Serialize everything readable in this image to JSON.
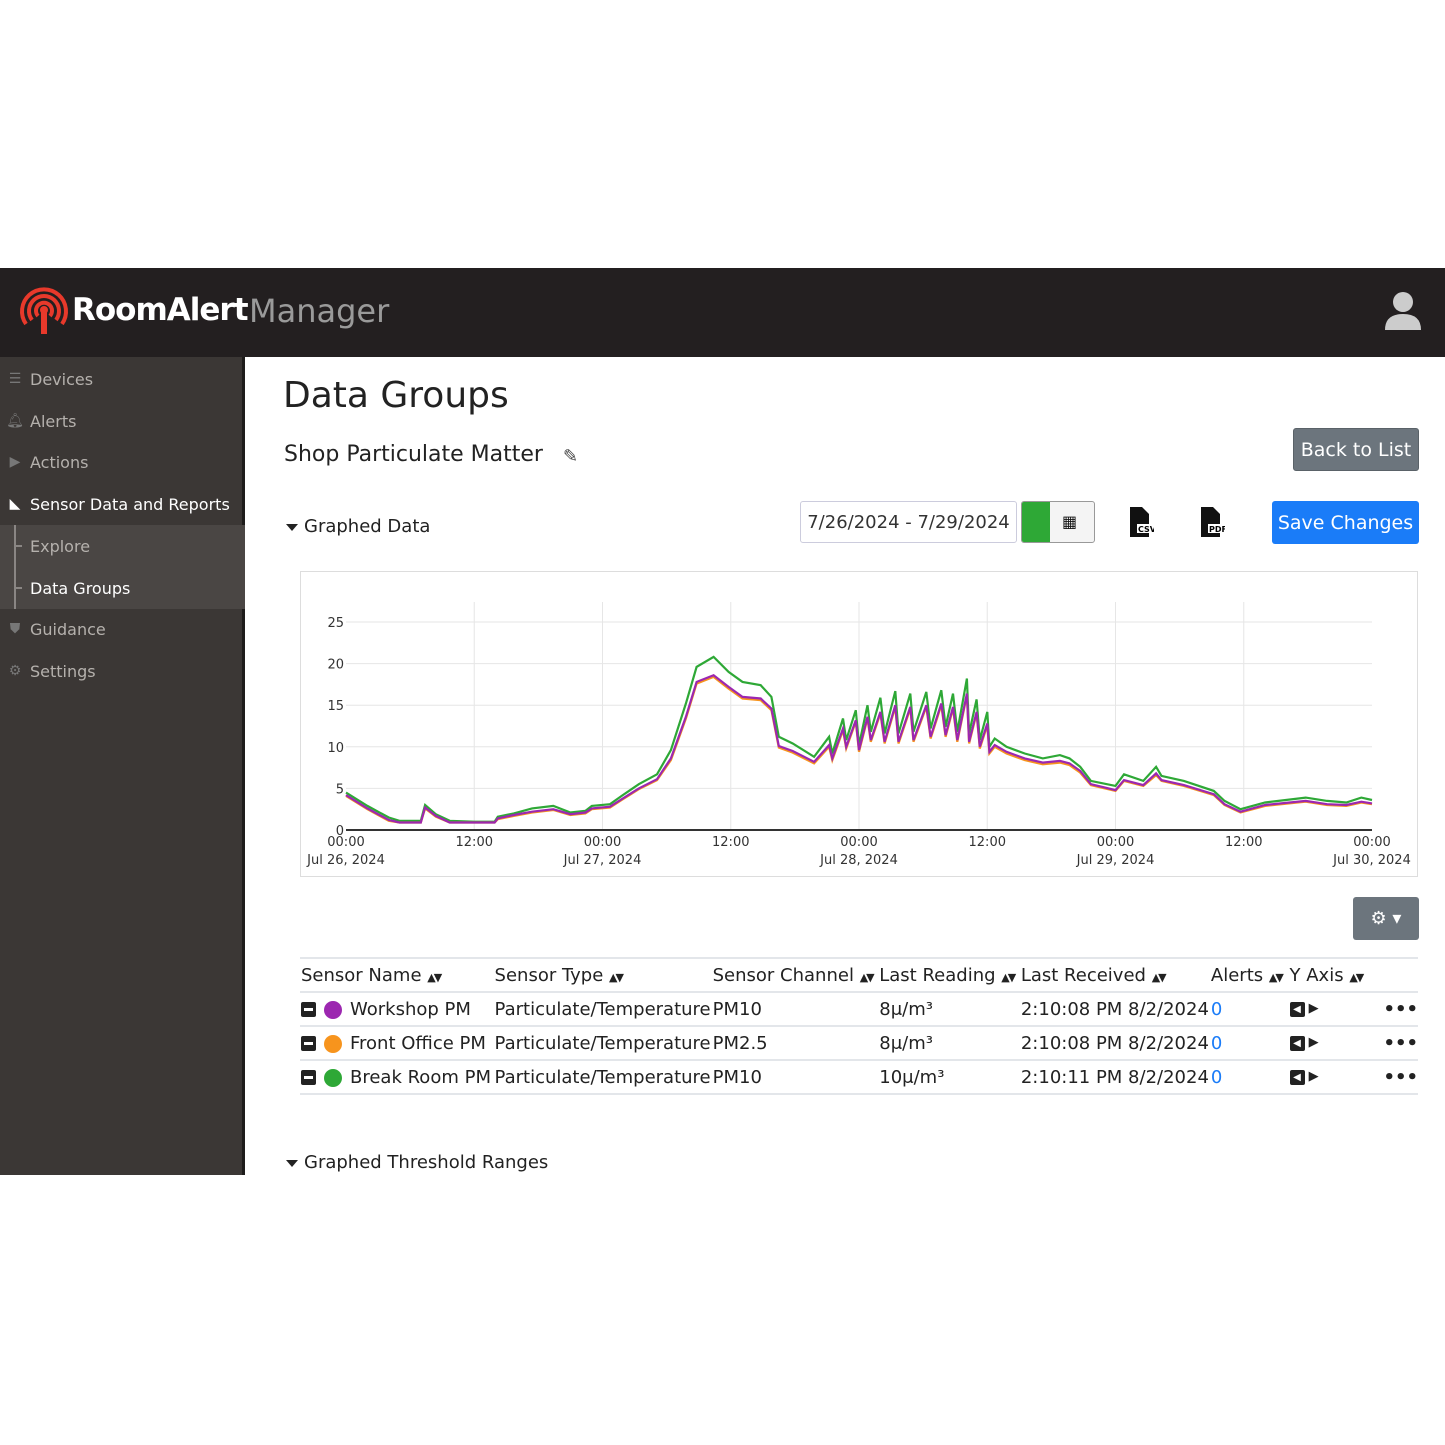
{
  "header": {
    "brand": "RoomAlert",
    "product": "Manager",
    "user_icon": "user-icon",
    "logo_color": "#e8392b"
  },
  "sidebar": {
    "items": [
      {
        "label": "Devices",
        "icon": "list-icon"
      },
      {
        "label": "Alerts",
        "icon": "bell-icon"
      },
      {
        "label": "Actions",
        "icon": "play-circle-icon"
      },
      {
        "label": "Sensor Data and Reports",
        "icon": "area-chart-icon",
        "active": true
      },
      {
        "label": "Explore",
        "sub": true
      },
      {
        "label": "Data Groups",
        "sub": true,
        "active": true
      },
      {
        "label": "Guidance",
        "icon": "shield-icon"
      },
      {
        "label": "Settings",
        "icon": "gear-icon"
      }
    ]
  },
  "main": {
    "title": "Data Groups",
    "group_name": "Shop Particulate Matter",
    "back_label": "Back to List",
    "graphed_data_label": "Graphed Data",
    "date_range": "7/26/2024 - 7/29/2024",
    "selected_color": "#2ea836",
    "csv_label": "CSV",
    "pdf_label": "PDF",
    "save_label": "Save Changes",
    "threshold_label": "Graphed Threshold Ranges"
  },
  "chart_data": {
    "type": "line",
    "ylim": [
      0,
      25
    ],
    "yticks": [
      0,
      5,
      10,
      15,
      20,
      25
    ],
    "xlim": [
      "2024-07-26T00:00",
      "2024-07-30T00:00"
    ],
    "xticks": [
      {
        "time": "2024-07-26T00:00",
        "label": "00:00",
        "date": "Jul 26, 2024"
      },
      {
        "time": "2024-07-26T12:00",
        "label": "12:00",
        "date": ""
      },
      {
        "time": "2024-07-27T00:00",
        "label": "00:00",
        "date": "Jul 27, 2024"
      },
      {
        "time": "2024-07-27T12:00",
        "label": "12:00",
        "date": ""
      },
      {
        "time": "2024-07-28T00:00",
        "label": "00:00",
        "date": "Jul 28, 2024"
      },
      {
        "time": "2024-07-28T12:00",
        "label": "12:00",
        "date": ""
      },
      {
        "time": "2024-07-29T00:00",
        "label": "00:00",
        "date": "Jul 29, 2024"
      },
      {
        "time": "2024-07-29T12:00",
        "label": "12:00",
        "date": ""
      },
      {
        "time": "2024-07-30T00:00",
        "label": "00:00",
        "date": "Jul 30, 2024"
      }
    ],
    "grid": true,
    "x": [
      "2024-07-26T00:00",
      "2024-07-26T02:00",
      "2024-07-26T04:00",
      "2024-07-26T05:00",
      "2024-07-26T07:00",
      "2024-07-26T07:24",
      "2024-07-26T08:24",
      "2024-07-26T09:42",
      "2024-07-26T12:00",
      "2024-07-26T13:54",
      "2024-07-26T14:12",
      "2024-07-26T15:42",
      "2024-07-26T17:24",
      "2024-07-26T19:24",
      "2024-07-26T21:00",
      "2024-07-26T22:24",
      "2024-07-26T23:00",
      "2024-07-27T00:42",
      "2024-07-27T01:48",
      "2024-07-27T03:24",
      "2024-07-27T05:06",
      "2024-07-27T06:24",
      "2024-07-27T07:48",
      "2024-07-27T08:48",
      "2024-07-27T10:24",
      "2024-07-27T11:48",
      "2024-07-27T13:06",
      "2024-07-27T14:48",
      "2024-07-27T15:48",
      "2024-07-27T16:30",
      "2024-07-27T17:48",
      "2024-07-27T19:48",
      "2024-07-27T21:12",
      "2024-07-27T21:30",
      "2024-07-27T22:30",
      "2024-07-27T22:48",
      "2024-07-27T23:42",
      "2024-07-28T00:00",
      "2024-07-28T00:48",
      "2024-07-28T01:06",
      "2024-07-28T02:00",
      "2024-07-28T02:24",
      "2024-07-28T03:24",
      "2024-07-28T03:42",
      "2024-07-28T04:48",
      "2024-07-28T05:06",
      "2024-07-28T06:18",
      "2024-07-28T06:42",
      "2024-07-28T07:42",
      "2024-07-28T08:06",
      "2024-07-28T08:48",
      "2024-07-28T09:12",
      "2024-07-28T10:06",
      "2024-07-28T10:18",
      "2024-07-28T11:00",
      "2024-07-28T11:18",
      "2024-07-28T12:00",
      "2024-07-28T12:12",
      "2024-07-28T12:42",
      "2024-07-28T13:48",
      "2024-07-28T15:30",
      "2024-07-28T17:12",
      "2024-07-28T18:48",
      "2024-07-28T19:42",
      "2024-07-28T20:42",
      "2024-07-28T21:42",
      "2024-07-29T00:00",
      "2024-07-29T00:48",
      "2024-07-29T02:36",
      "2024-07-29T03:48",
      "2024-07-29T04:18",
      "2024-07-29T06:24",
      "2024-07-29T09:12",
      "2024-07-29T10:12",
      "2024-07-29T11:42",
      "2024-07-29T14:00",
      "2024-07-29T17:48",
      "2024-07-29T19:48",
      "2024-07-29T21:36",
      "2024-07-29T23:00",
      "2024-07-30T00:00"
    ],
    "series": [
      {
        "name": "Break Room PM",
        "color": "#2ea836",
        "values": [
          4.5,
          2.9,
          1.5,
          1.1,
          1.1,
          3.0,
          1.9,
          1.1,
          1.0,
          1.0,
          1.6,
          2.0,
          2.6,
          2.9,
          2.1,
          2.3,
          2.9,
          3.1,
          4.1,
          5.5,
          6.7,
          9.6,
          15.2,
          19.6,
          20.8,
          19.0,
          17.8,
          17.4,
          16.0,
          11.2,
          10.4,
          8.8,
          11.2,
          9.2,
          13.4,
          10.8,
          14.4,
          10.2,
          15.0,
          11.8,
          15.9,
          11.6,
          16.7,
          11.6,
          16.4,
          11.8,
          16.6,
          12.2,
          16.8,
          12.4,
          16.4,
          11.8,
          18.2,
          11.6,
          15.7,
          10.8,
          14.2,
          10.0,
          11.0,
          10.0,
          9.2,
          8.6,
          9.0,
          8.6,
          7.6,
          5.9,
          5.3,
          6.7,
          5.9,
          7.6,
          6.5,
          5.9,
          4.7,
          3.5,
          2.5,
          3.3,
          3.9,
          3.5,
          3.3,
          3.9,
          3.6
        ]
      },
      {
        "name": "Front Office PM",
        "color": "#f7941d",
        "values": [
          4.1,
          2.5,
          1.1,
          0.9,
          0.9,
          2.6,
          1.6,
          0.9,
          0.9,
          0.9,
          1.3,
          1.7,
          2.1,
          2.4,
          1.8,
          2.0,
          2.5,
          2.7,
          3.6,
          4.9,
          6.0,
          8.4,
          13.4,
          17.6,
          18.4,
          17.0,
          15.8,
          15.6,
          14.4,
          9.9,
          9.3,
          8.0,
          10.0,
          8.4,
          12.0,
          9.8,
          13.0,
          9.4,
          13.4,
          10.6,
          14.0,
          10.4,
          14.8,
          10.4,
          14.6,
          10.6,
          14.8,
          11.0,
          15.0,
          11.2,
          14.6,
          10.6,
          16.2,
          10.4,
          14.0,
          9.8,
          12.6,
          9.2,
          10.0,
          9.2,
          8.4,
          7.9,
          8.1,
          7.8,
          6.9,
          5.4,
          4.7,
          5.9,
          5.3,
          6.6,
          5.9,
          5.3,
          4.2,
          3.0,
          2.1,
          2.9,
          3.4,
          3.0,
          2.9,
          3.3,
          3.1
        ]
      },
      {
        "name": "Workshop PM",
        "color": "#9c27b0",
        "values": [
          4.2,
          2.6,
          1.2,
          0.9,
          0.9,
          2.7,
          1.7,
          0.9,
          0.9,
          0.9,
          1.4,
          1.8,
          2.2,
          2.5,
          1.9,
          2.1,
          2.6,
          2.8,
          3.7,
          5.0,
          6.1,
          8.6,
          13.6,
          17.8,
          18.6,
          17.2,
          16.0,
          15.8,
          14.6,
          10.1,
          9.5,
          8.2,
          10.2,
          8.6,
          12.2,
          10.0,
          13.2,
          9.6,
          13.6,
          10.8,
          14.2,
          10.6,
          15.0,
          10.6,
          14.8,
          10.8,
          15.0,
          11.2,
          15.2,
          11.4,
          14.8,
          10.8,
          16.4,
          10.6,
          14.2,
          10.0,
          12.8,
          9.4,
          10.2,
          9.4,
          8.6,
          8.1,
          8.3,
          8.0,
          7.1,
          5.5,
          4.8,
          6.0,
          5.4,
          6.8,
          6.0,
          5.4,
          4.3,
          3.1,
          2.2,
          3.0,
          3.5,
          3.1,
          3.0,
          3.4,
          3.2
        ]
      }
    ]
  },
  "table": {
    "gear_icon": "gear-dropdown-icon",
    "columns": [
      "Sensor Name",
      "Sensor Type",
      "Sensor Channel",
      "Last Reading",
      "Last Received",
      "Alerts",
      "Y Axis"
    ],
    "rows": [
      {
        "name": "Workshop PM",
        "color": "#9c27b0",
        "type": "Particulate/Temperature",
        "channel": "PM10",
        "reading": "8μ/m³",
        "received": "2:10:08 PM 8/2/2024",
        "alerts": "0"
      },
      {
        "name": "Front Office PM",
        "color": "#f7941d",
        "type": "Particulate/Temperature",
        "channel": "PM2.5",
        "reading": "8μ/m³",
        "received": "2:10:08 PM 8/2/2024",
        "alerts": "0"
      },
      {
        "name": "Break Room PM",
        "color": "#2ea836",
        "type": "Particulate/Temperature",
        "channel": "PM10",
        "reading": "10μ/m³",
        "received": "2:10:11 PM 8/2/2024",
        "alerts": "0"
      }
    ]
  }
}
